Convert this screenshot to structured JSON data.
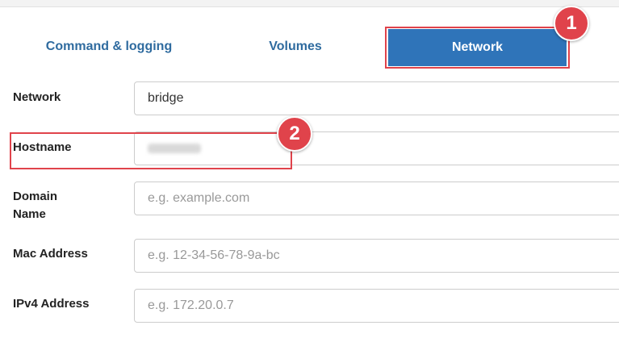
{
  "tabs": {
    "command_logging": "Command & logging",
    "volumes": "Volumes",
    "network": "Network"
  },
  "annotations": {
    "step1": "1",
    "step2": "2"
  },
  "form": {
    "network": {
      "label": "Network",
      "value": "bridge"
    },
    "hostname": {
      "label": "Hostname",
      "value_hidden": true
    },
    "domain_name": {
      "label_line1": "Domain",
      "label_line2": "Name",
      "placeholder": "e.g. example.com"
    },
    "mac_address": {
      "label": "Mac Address",
      "placeholder": "e.g. 12-34-56-78-9a-bc"
    },
    "ipv4_address": {
      "label": "IPv4 Address",
      "placeholder": "e.g. 172.20.0.7"
    }
  },
  "colors": {
    "accent": "#2f74b9",
    "tab_text": "#2f6b9f",
    "annotation": "#e0434b"
  }
}
